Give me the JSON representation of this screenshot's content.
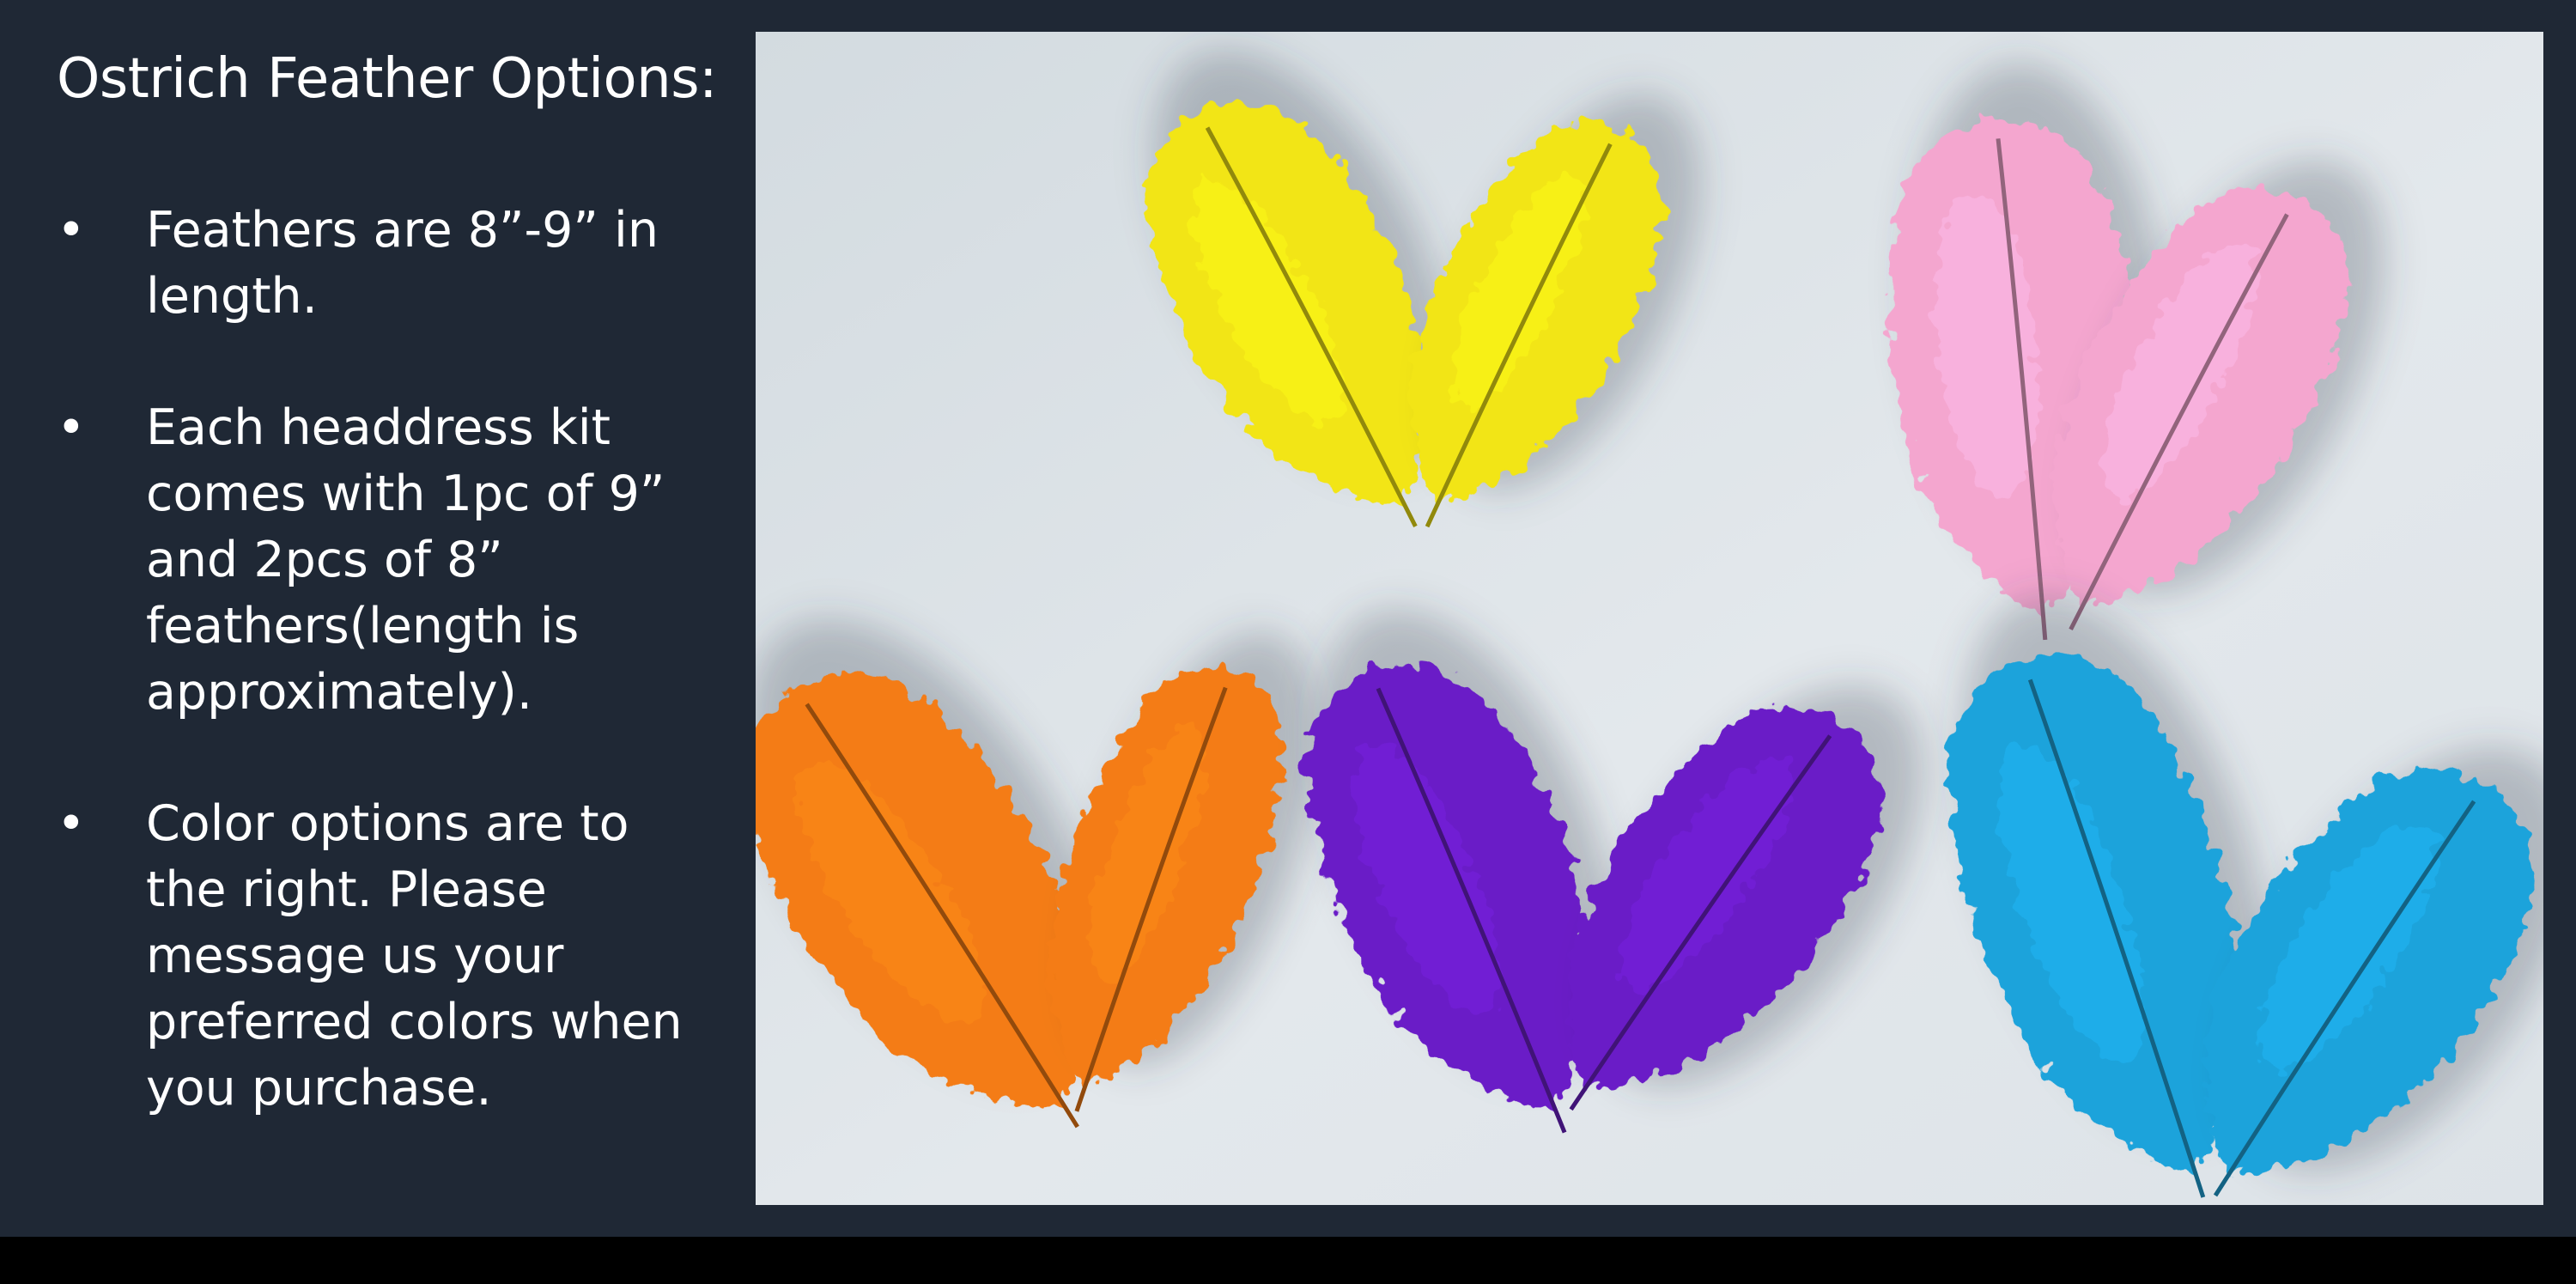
{
  "slide": {
    "title": "Ostrich Feather Options:",
    "bullet_marker": "•",
    "bullets": [
      "Feathers are 8”-9” in length.",
      "Each headdress kit comes with 1pc of 9” and 2pcs of 8” feathers(length is approximately).",
      "Color options are to the right. Please message us your preferred colors when you purchase."
    ]
  },
  "photo": {
    "feather_colors": {
      "yellow": "#f2e514",
      "pink": "#f4a6cf",
      "orange": "#f47c14",
      "purple": "#6a1fc7",
      "blue": "#1fa3db"
    }
  }
}
